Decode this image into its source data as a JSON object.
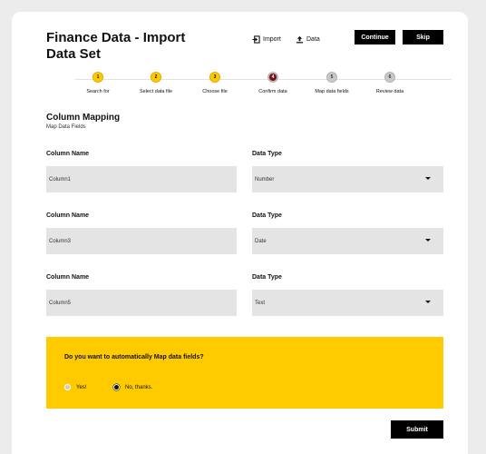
{
  "header": {
    "title": "Finance Data - Import Data Set",
    "import_label": "Import",
    "data_label": "Data",
    "continue_label": "Continue",
    "skip_label": "Skip"
  },
  "steps": [
    {
      "num": "1",
      "label": "Search for",
      "state": "done"
    },
    {
      "num": "2",
      "label": "Select data file",
      "state": "done"
    },
    {
      "num": "3",
      "label": "Choose file",
      "state": "done"
    },
    {
      "num": "4",
      "label": "Confirm data",
      "state": "active"
    },
    {
      "num": "5",
      "label": "Map data fields",
      "state": "todo"
    },
    {
      "num": "6",
      "label": "Review data",
      "state": "todo"
    }
  ],
  "section": {
    "title": "Column Mapping",
    "subtitle": "Map Data Fields"
  },
  "mappings": [
    {
      "name_label": "Column Name",
      "name_value": "Column1",
      "type_label": "Data Type",
      "type_value": "Number"
    },
    {
      "name_label": "Column Name",
      "name_value": "Column3",
      "type_label": "Data Type",
      "type_value": "Date"
    },
    {
      "name_label": "Column Name",
      "name_value": "Column5",
      "type_label": "Data Type",
      "type_value": "Text"
    }
  ],
  "auto_map": {
    "question": "Do you want to automatically Map data fields?",
    "yes_label": "Yes!",
    "no_label": "No, thanks.",
    "selected": "no"
  },
  "submit_label": "Submit",
  "colors": {
    "accent": "#ffca00",
    "active_step": "#7a1212",
    "button": "#000000"
  }
}
